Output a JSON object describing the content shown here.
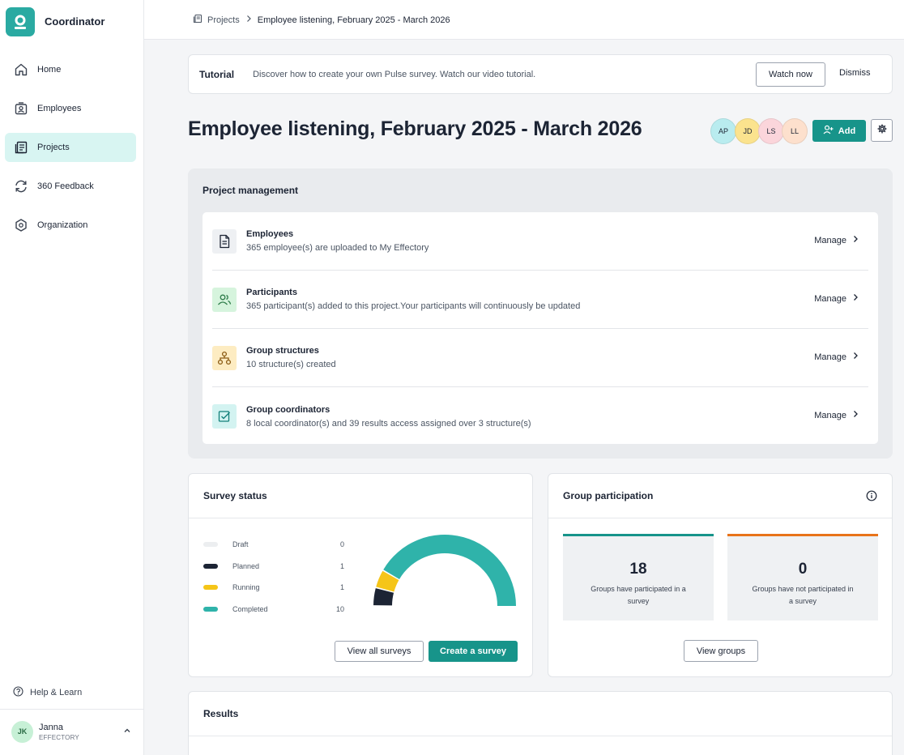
{
  "app": {
    "name": "Coordinator"
  },
  "sidebar": {
    "items": [
      {
        "label": "Home",
        "icon": "home-icon"
      },
      {
        "label": "Employees",
        "icon": "employees-icon"
      },
      {
        "label": "Projects",
        "icon": "projects-icon",
        "active": true
      },
      {
        "label": "360 Feedback",
        "icon": "refresh-icon"
      },
      {
        "label": "Organization",
        "icon": "hexagon-icon"
      }
    ],
    "help_label": "Help & Learn",
    "user": {
      "initials": "JK",
      "name": "Janna",
      "org": "EFFECTORY"
    }
  },
  "breadcrumb": {
    "root": "Projects",
    "current": "Employee listening, February 2025 - March 2026"
  },
  "tutorial": {
    "title": "Tutorial",
    "text": "Discover how to create your own Pulse survey. Watch our video tutorial.",
    "watch_label": "Watch now",
    "dismiss_label": "Dismiss"
  },
  "page": {
    "title": "Employee listening, February 2025 - March 2026",
    "avatars": [
      {
        "initials": "AP",
        "color": "#b9ecef"
      },
      {
        "initials": "JD",
        "color": "#fbe38e"
      },
      {
        "initials": "LS",
        "color": "#fbd5db"
      },
      {
        "initials": "LL",
        "color": "#fde0cd"
      }
    ],
    "add_label": "Add"
  },
  "project_management": {
    "title": "Project management",
    "manage_label": "Manage",
    "rows": [
      {
        "title": "Employees",
        "desc": "365 employee(s) are uploaded to My Effectory",
        "icon": "document-icon"
      },
      {
        "title": "Participants",
        "desc": "365 participant(s) added to this project.Your participants will continuously be updated",
        "icon": "users-icon"
      },
      {
        "title": "Group structures",
        "desc": "10 structure(s) created",
        "icon": "hierarchy-icon"
      },
      {
        "title": "Group coordinators",
        "desc": "8 local coordinator(s) and 39 results access assigned over 3 structure(s)",
        "icon": "checkbox-icon"
      }
    ]
  },
  "survey_status": {
    "title": "Survey status",
    "legend": [
      {
        "label": "Draft",
        "count": "0",
        "color": "#eceef0"
      },
      {
        "label": "Planned",
        "count": "1",
        "color": "#1c2434"
      },
      {
        "label": "Running",
        "count": "1",
        "color": "#f5c518"
      },
      {
        "label": "Completed",
        "count": "10",
        "color": "#2fb3aa"
      }
    ],
    "view_all_label": "View all surveys",
    "create_label": "Create a survey"
  },
  "chart_data": {
    "type": "pie",
    "variant": "half-donut",
    "categories": [
      "Draft",
      "Planned",
      "Running",
      "Completed"
    ],
    "values": [
      0,
      1,
      1,
      10
    ],
    "colors": [
      "#eceef0",
      "#1c2434",
      "#f5c518",
      "#2fb3aa"
    ]
  },
  "group_participation": {
    "title": "Group participation",
    "stats": [
      {
        "value": "18",
        "label": "Groups have participated in a survey",
        "color": "#17948a"
      },
      {
        "value": "0",
        "label": "Groups have not participated in a survey",
        "color": "#e8731a"
      }
    ],
    "view_groups_label": "View groups"
  },
  "results": {
    "title": "Results"
  }
}
